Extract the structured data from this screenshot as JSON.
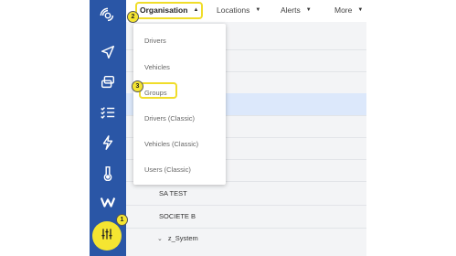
{
  "sidebar": {
    "items": [
      {
        "icon": "live-map-icon"
      },
      {
        "icon": "send-icon"
      },
      {
        "icon": "vehicles-icon"
      },
      {
        "icon": "checklist-icon"
      },
      {
        "icon": "lightning-icon"
      },
      {
        "icon": "thermometer-icon"
      },
      {
        "icon": "w-logo-icon"
      },
      {
        "icon": "settings-sliders-icon"
      }
    ]
  },
  "topbar": {
    "menu": [
      {
        "label": "Organisation",
        "active": true
      },
      {
        "label": "Locations"
      },
      {
        "label": "Alerts"
      },
      {
        "label": "More"
      }
    ],
    "caret": "▲",
    "caret_down": "▼"
  },
  "dropdown": {
    "items": [
      {
        "label": "Drivers"
      },
      {
        "label": "Vehicles"
      },
      {
        "label": "Groups"
      },
      {
        "label": "Drivers (Classic)"
      },
      {
        "label": "Vehicles (Classic)"
      },
      {
        "label": "Users (Classic)"
      }
    ]
  },
  "content": {
    "tree": [
      {
        "label": "SA TEST"
      },
      {
        "label": "SOCIETE B"
      },
      {
        "label": "z_System",
        "chevron": "⌄"
      }
    ]
  },
  "callouts": [
    "1",
    "2",
    "3"
  ],
  "colors": {
    "sidebar": "#2a56a6",
    "highlight": "#f5e531",
    "selected_row": "#dce8fb",
    "content_bg": "#f3f4f6"
  }
}
